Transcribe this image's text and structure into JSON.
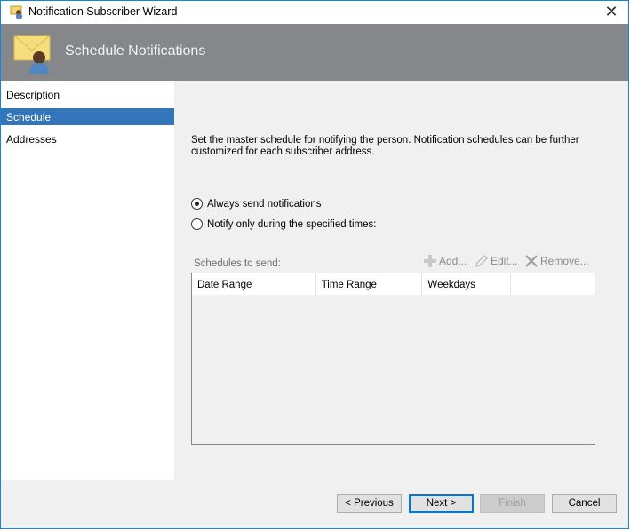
{
  "window": {
    "title": "Notification Subscriber Wizard",
    "close": "✕"
  },
  "header": {
    "title": "Schedule Notifications"
  },
  "sidebar": {
    "items": [
      {
        "label": "Description"
      },
      {
        "label": "Schedule",
        "selected": true
      },
      {
        "label": "Addresses"
      }
    ]
  },
  "main": {
    "intro": "Set the master schedule for notifying the person. Notification schedules can be further customized for each subscriber address.",
    "radios": [
      {
        "label": "Always send notifications",
        "checked": true
      },
      {
        "label": "Notify only during the specified times:",
        "checked": false
      }
    ],
    "schedules_label": "Schedules to send:",
    "toolbar": {
      "add": "Add...",
      "edit": "Edit...",
      "remove": "Remove..."
    },
    "table": {
      "columns": [
        "Date Range",
        "Time Range",
        "Weekdays",
        ""
      ],
      "rows": []
    }
  },
  "footer": {
    "previous": "< Previous",
    "next": "Next >",
    "finish": "Finish",
    "cancel": "Cancel"
  }
}
